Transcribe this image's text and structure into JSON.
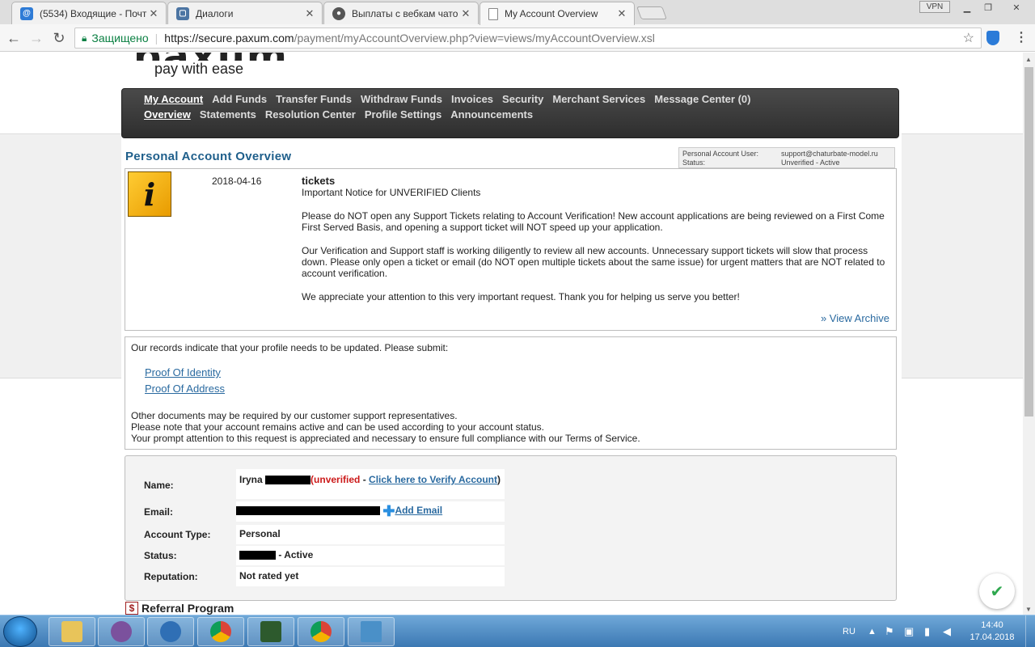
{
  "browser": {
    "tabs": [
      {
        "title": "(5534) Входящие - Почт",
        "icon": "mail-at-icon",
        "color": "#2e7bd6"
      },
      {
        "title": "Диалоги",
        "icon": "vk-icon",
        "color": "#4c75a3"
      },
      {
        "title": "Выплаты с вебкам чато",
        "icon": "forum-icon",
        "color": "#555555"
      },
      {
        "title": "My Account Overview",
        "icon": "page-icon",
        "color": "#888888"
      }
    ],
    "vpn_label": "VPN",
    "secure_label": "Защищено",
    "url_host": "https://secure.paxum.com",
    "url_path": "/payment/myAccountOverview.php?view=views/myAccountOverview.xsl"
  },
  "site": {
    "logo_tagline": "pay with ease",
    "nav_row1": [
      "My Account",
      "Add Funds",
      "Transfer Funds",
      "Withdraw Funds",
      "Invoices",
      "Security",
      "Merchant Services",
      "Message Center (0)"
    ],
    "nav_row2": [
      "Overview",
      "Statements",
      "Resolution Center",
      "Profile Settings",
      "Announcements"
    ]
  },
  "overview": {
    "title": "Personal Account Overview",
    "user_label": "Personal Account User:",
    "user_value": "support@chaturbate-model.ru",
    "status_label": "Status:",
    "status_value": "Unverified - Active"
  },
  "notice": {
    "date": "2018-04-16",
    "title": "tickets",
    "subtitle": "Important Notice for UNVERIFIED Clients",
    "p1": "Please do NOT open any Support Tickets relating to Account Verification! New account applications are being reviewed on a First Come First Served Basis, and opening a support ticket will NOT speed up your application.",
    "p2": "Our Verification and Support staff is working diligently to review all new accounts. Unnecessary support tickets will slow that process down. Please only open a ticket or email (do NOT open multiple tickets about the same issue) for urgent matters that are NOT related to account verification.",
    "p3": "We appreciate your attention to this very important request. Thank you for helping us serve you better!",
    "archive_link": "» View Archive"
  },
  "profile_update": {
    "intro": "Our records indicate that your profile needs to be updated. Please submit:",
    "doc1": "Proof Of Identity",
    "doc2": "Proof Of Address",
    "line1": "Other documents may be required by our customer support representatives.",
    "line2": "Please note that your account remains active and can be used according to your account status.",
    "line3": "Your prompt attention to this request is appreciated and necessary to ensure full compliance with our Terms of Service."
  },
  "account": {
    "name_label": "Name:",
    "name_first": "Iryna",
    "unverified_text": "(unverified",
    "dash": " - ",
    "verify_link": "Click here to Verify Account",
    "close_paren": ")",
    "email_label": "Email:",
    "add_email": "Add Email",
    "type_label": "Account Type:",
    "type_value": "Personal",
    "status_label": "Status:",
    "status_suffix": " - Active",
    "reputation_label": "Reputation:",
    "reputation_value": "Not rated yet"
  },
  "referral": {
    "title": "Referral Program"
  },
  "taskbar": {
    "lang": "RU",
    "time": "14:40",
    "date": "17.04.2018"
  }
}
